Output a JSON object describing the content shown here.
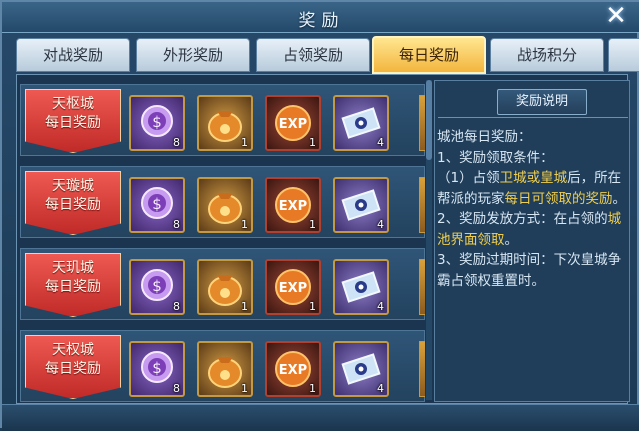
{
  "window": {
    "title": "奖励"
  },
  "tabs": [
    {
      "label": "对战奖励",
      "active": false
    },
    {
      "label": "外形奖励",
      "active": false
    },
    {
      "label": "占领奖励",
      "active": false
    },
    {
      "label": "每日奖励",
      "active": true
    },
    {
      "label": "战场积分",
      "active": false
    }
  ],
  "rewards": [
    {
      "banner_line1": "天枢城",
      "banner_line2": "每日奖励",
      "items": [
        {
          "icon": "purple-orb-icon",
          "count": "8"
        },
        {
          "icon": "gold-bag-icon",
          "count": "1"
        },
        {
          "icon": "exp-orb-icon",
          "label": "EXP",
          "count": "1"
        },
        {
          "icon": "scroll-icon",
          "count": "4"
        }
      ]
    },
    {
      "banner_line1": "天璇城",
      "banner_line2": "每日奖励",
      "items": [
        {
          "icon": "purple-orb-icon",
          "count": "8"
        },
        {
          "icon": "gold-bag-icon",
          "count": "1"
        },
        {
          "icon": "exp-orb-icon",
          "label": "EXP",
          "count": "1"
        },
        {
          "icon": "scroll-icon",
          "count": "4"
        }
      ]
    },
    {
      "banner_line1": "天玑城",
      "banner_line2": "每日奖励",
      "items": [
        {
          "icon": "purple-orb-icon",
          "count": "8"
        },
        {
          "icon": "gold-bag-icon",
          "count": "1"
        },
        {
          "icon": "exp-orb-icon",
          "label": "EXP",
          "count": "1"
        },
        {
          "icon": "scroll-icon",
          "count": "4"
        }
      ]
    },
    {
      "banner_line1": "天权城",
      "banner_line2": "每日奖励",
      "items": [
        {
          "icon": "purple-orb-icon",
          "count": "8"
        },
        {
          "icon": "gold-bag-icon",
          "count": "1"
        },
        {
          "icon": "exp-orb-icon",
          "label": "EXP",
          "count": "1"
        },
        {
          "icon": "scroll-icon",
          "count": "4"
        }
      ]
    }
  ],
  "info": {
    "heading": "奖励说明",
    "p1": "城池每日奖励：",
    "p2": "1、奖励领取条件：",
    "p3a": "（1）占领",
    "p3b": "卫城或皇城",
    "p3c": "后，所在帮派的玩家",
    "p3d": "每日可领取的奖励",
    "p3e": "。",
    "p4a": "2、奖励发放方式：在占领的",
    "p4b": "城池界面领取",
    "p4c": "。",
    "p5": "3、奖励过期时间：下次皇城争霸占领权重置时。"
  },
  "colors": {
    "highlight": "#f0cf4e",
    "active_tab": "#f3b53e",
    "banner": "#c02a28"
  }
}
